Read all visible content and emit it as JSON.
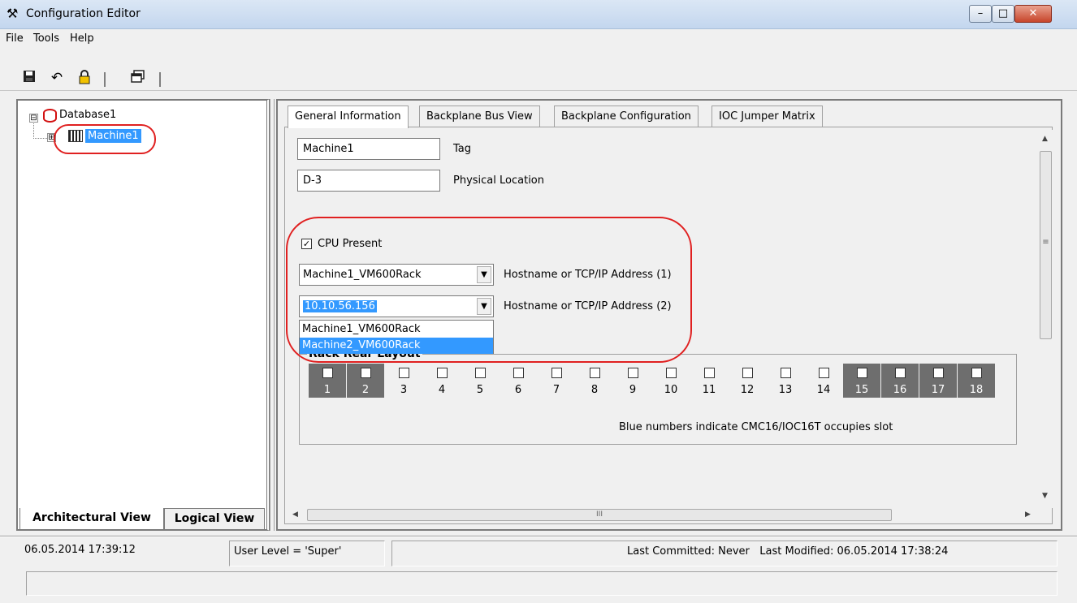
{
  "window": {
    "title": "Configuration Editor",
    "app_icon": "tools-icon",
    "min_glyph": "–",
    "max_glyph": "□",
    "close_glyph": "✕"
  },
  "menu": {
    "items": [
      "File",
      "Tools",
      "Help"
    ]
  },
  "toolbar": {
    "icons": [
      "save-icon",
      "undo-icon",
      "lock-icon",
      "window-list-icon"
    ]
  },
  "tree": {
    "root_label": "Database1",
    "child_label": "Machine1",
    "root_expander": "⊟",
    "child_expander": "⊞"
  },
  "left_tabs": [
    "Architectural View",
    "Logical View"
  ],
  "tabs": [
    "General Information",
    "Backplane Bus View",
    "Backplane Configuration",
    "IOC Jumper Matrix"
  ],
  "general": {
    "tag_value": "Machine1",
    "tag_label": "Tag",
    "location_value": "D-3",
    "location_label": "Physical Location",
    "cpu_present_label": "CPU Present",
    "cpu_present_checked": true,
    "host1_value": "Machine1_VM600Rack",
    "host1_label": "Hostname or TCP/IP Address (1)",
    "host2_value": "10.10.56.156",
    "host2_label": "Hostname or TCP/IP Address (2)",
    "dropdown_options": [
      "Machine1_VM600Rack",
      "Machine2_VM600Rack"
    ],
    "dropdown_highlighted": "Machine2_VM600Rack"
  },
  "rack": {
    "title": "Rack Rear Layout",
    "slots": [
      "1",
      "2",
      "3",
      "4",
      "5",
      "6",
      "7",
      "8",
      "9",
      "10",
      "11",
      "12",
      "13",
      "14",
      "15",
      "16",
      "17",
      "18"
    ],
    "occupied": [
      "1",
      "2",
      "15",
      "16",
      "17",
      "18"
    ],
    "note": "Blue numbers indicate CMC16/IOC16T occupies slot"
  },
  "scroll": {
    "hscroll_glyph": "III",
    "vscroll_glyph": "≡"
  },
  "status": {
    "datetime": "06.05.2014 17:39:12",
    "user_level": "User Level = 'Super'",
    "commit_info": "Last Committed: Never   Last Modified: 06.05.2014 17:38:24"
  }
}
